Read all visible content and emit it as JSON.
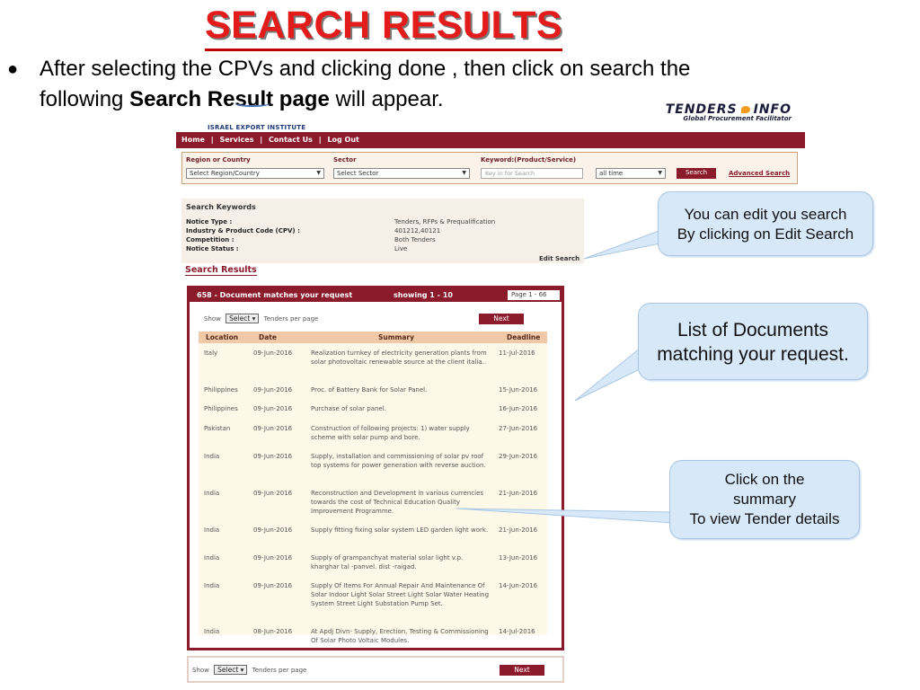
{
  "slide": {
    "title": "SEARCH RESULTS",
    "bullet_text_1": "After selecting the CPVs and clicking done , then click on search the",
    "bullet_text_2_pre": "following ",
    "bullet_text_2_bold": "Search Result page",
    "bullet_text_2_post": " will appear."
  },
  "site": {
    "logo_left": "ISRAEL EXPORT INSTITUTE",
    "logo_right_brand_a": "TENDERS",
    "logo_right_brand_b": "INFO",
    "logo_right_tag": "Global Procurement Facilitator",
    "nav": [
      "Home",
      "|",
      "Services",
      "|",
      "Contact Us",
      "|",
      "Log Out"
    ],
    "search": {
      "region_label": "Region or Country",
      "region_value": "Select Region/Country",
      "sector_label": "Sector",
      "sector_value": "Select Sector",
      "keyword_label": "Keyword:(Product/Service)",
      "keyword_placeholder": "Key in for Search",
      "time_value": "all time",
      "search_button": "Search",
      "advanced_link": "Advanced Search"
    },
    "keywords": {
      "title": "Search Keywords",
      "rows": [
        {
          "label": "Notice Type :",
          "value": "Tenders, RFPs & Prequalification"
        },
        {
          "label": "Industry & Product Code (CPV) :",
          "value": "401212,40121"
        },
        {
          "label": "Competition :",
          "value": "Both Tenders"
        },
        {
          "label": "Notice Status :",
          "value": "Live"
        }
      ],
      "edit_link": "Edit Search"
    },
    "results_title": "Search Results",
    "results": {
      "count_text": "658 - Document matches your request",
      "showing_text": "showing 1 - 10",
      "page_text": "Page 1 - 66",
      "show_label": "Show",
      "select_label": "Select",
      "per_page_label": "Tenders per page",
      "next_label": "Next",
      "columns": [
        "Location",
        "Date",
        "Summary",
        "Deadline"
      ],
      "rows": [
        {
          "location": "Italy",
          "date": "09-Jun-2016",
          "summary": "Realization turnkey of electricity generation plants from solar photovoltaic renewable source at the client italia..",
          "deadline": "11-Jul-2016"
        },
        {
          "location": "Philippines",
          "date": "09-Jun-2016",
          "summary": "Proc. of Battery Bank for Solar Panel.",
          "deadline": "15-Jun-2016"
        },
        {
          "location": "Philippines",
          "date": "09-Jun-2016",
          "summary": "Purchase of solar panel.",
          "deadline": "16-Jun-2016"
        },
        {
          "location": "Pakistan",
          "date": "09-Jun-2016",
          "summary": "Construction of following projects: 1) water supply scheme with solar pump and bore.",
          "deadline": "27-Jun-2016"
        },
        {
          "location": "India",
          "date": "09-Jun-2016",
          "summary": "Supply, installation and commissioning of solar pv roof top systems for power generation with reverse auction.",
          "deadline": "29-Jun-2016"
        },
        {
          "location": "India",
          "date": "09-Jun-2016",
          "summary": "Reconstruction and Development in various currencies towards the cost of Technical Education Quality Improvement Programme.",
          "deadline": "21-Jun-2016"
        },
        {
          "location": "India",
          "date": "09-Jun-2016",
          "summary": "Supply fitting fixing solar system LED garden light work.",
          "deadline": "21-Jun-2016"
        },
        {
          "location": "India",
          "date": "09-Jun-2016",
          "summary": "Supply of grampanchyat material solar light v.p. kharghar tal -panvel. dist -raigad.",
          "deadline": "13-Jun-2016"
        },
        {
          "location": "India",
          "date": "09-Jun-2016",
          "summary": "Supply Of Items For Annual Repair And Maintenance Of Solar Indoor Light Solar Street Light Solar Water Heating System Street Light Substation Pump Set.",
          "deadline": "14-Jun-2016"
        },
        {
          "location": "India",
          "date": "08-Jun-2016",
          "summary": "At Apdj Divn- Supply, Erection, Testing & Commissioning Of Solar Photo Voltaic Modules.",
          "deadline": "14-Jul-2016"
        }
      ]
    }
  },
  "callouts": {
    "edit_1": "You can edit you search",
    "edit_2": "By clicking on Edit Search",
    "list_1": "List of Documents",
    "list_2": "matching your request.",
    "click_1": "Click on the",
    "click_2": "summary",
    "click_3": "To view Tender details"
  },
  "colors": {
    "title_red": "#e31b1b",
    "brand_maroon": "#8b1a2b",
    "callout_blue": "#d7e9f9",
    "table_row_bg": "#fdf8e8"
  }
}
